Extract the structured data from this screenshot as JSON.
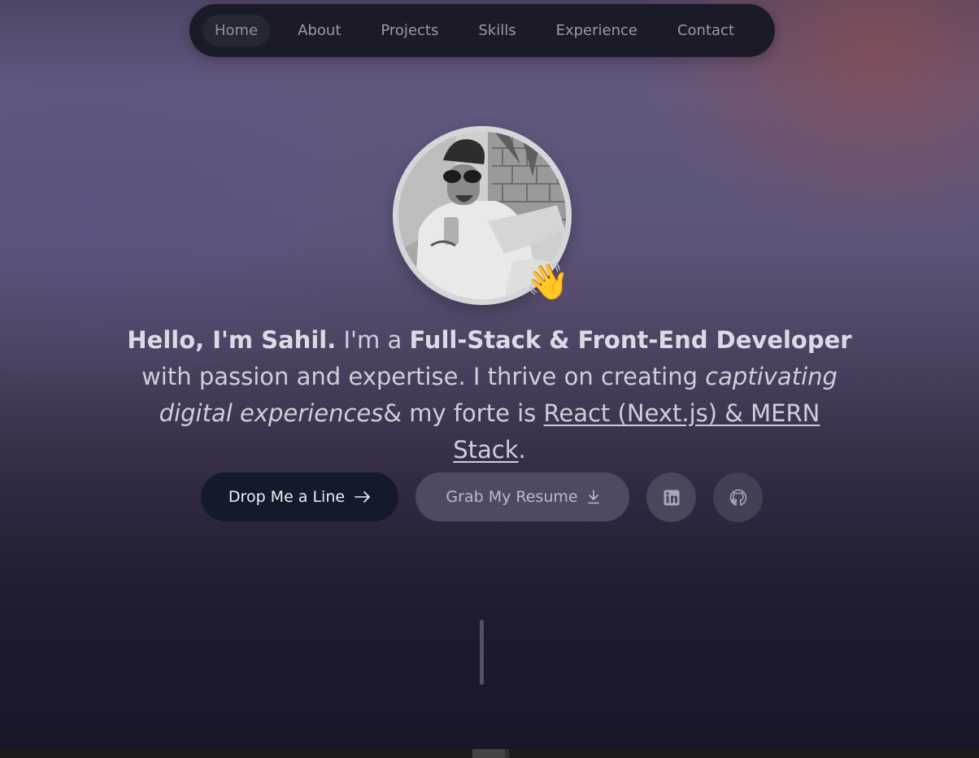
{
  "nav": {
    "items": [
      {
        "label": "Home",
        "active": true
      },
      {
        "label": "About"
      },
      {
        "label": "Projects"
      },
      {
        "label": "Skills"
      },
      {
        "label": "Experience"
      },
      {
        "label": "Contact"
      }
    ]
  },
  "hero": {
    "wave_emoji": "👋",
    "intro": {
      "greeting": "Hello, I'm Sahil.",
      "text1": " I'm a ",
      "role": "Full-Stack & Front-End Developer",
      "text2": " with passion and expertise. I thrive on creating ",
      "emphasis": "captivating digital experiences",
      "text3": "& my forte is ",
      "stack": "React (Next.js) & MERN Stack",
      "text4": "."
    }
  },
  "actions": {
    "contact_label": "Drop Me a Line",
    "resume_label": "Grab My Resume",
    "linkedin_icon": "linkedin-icon",
    "github_icon": "github-icon"
  },
  "colors": {
    "nav_bg": "#1b1a28",
    "primary_button": "#151a2b",
    "secondary_button": "#4f4961"
  }
}
